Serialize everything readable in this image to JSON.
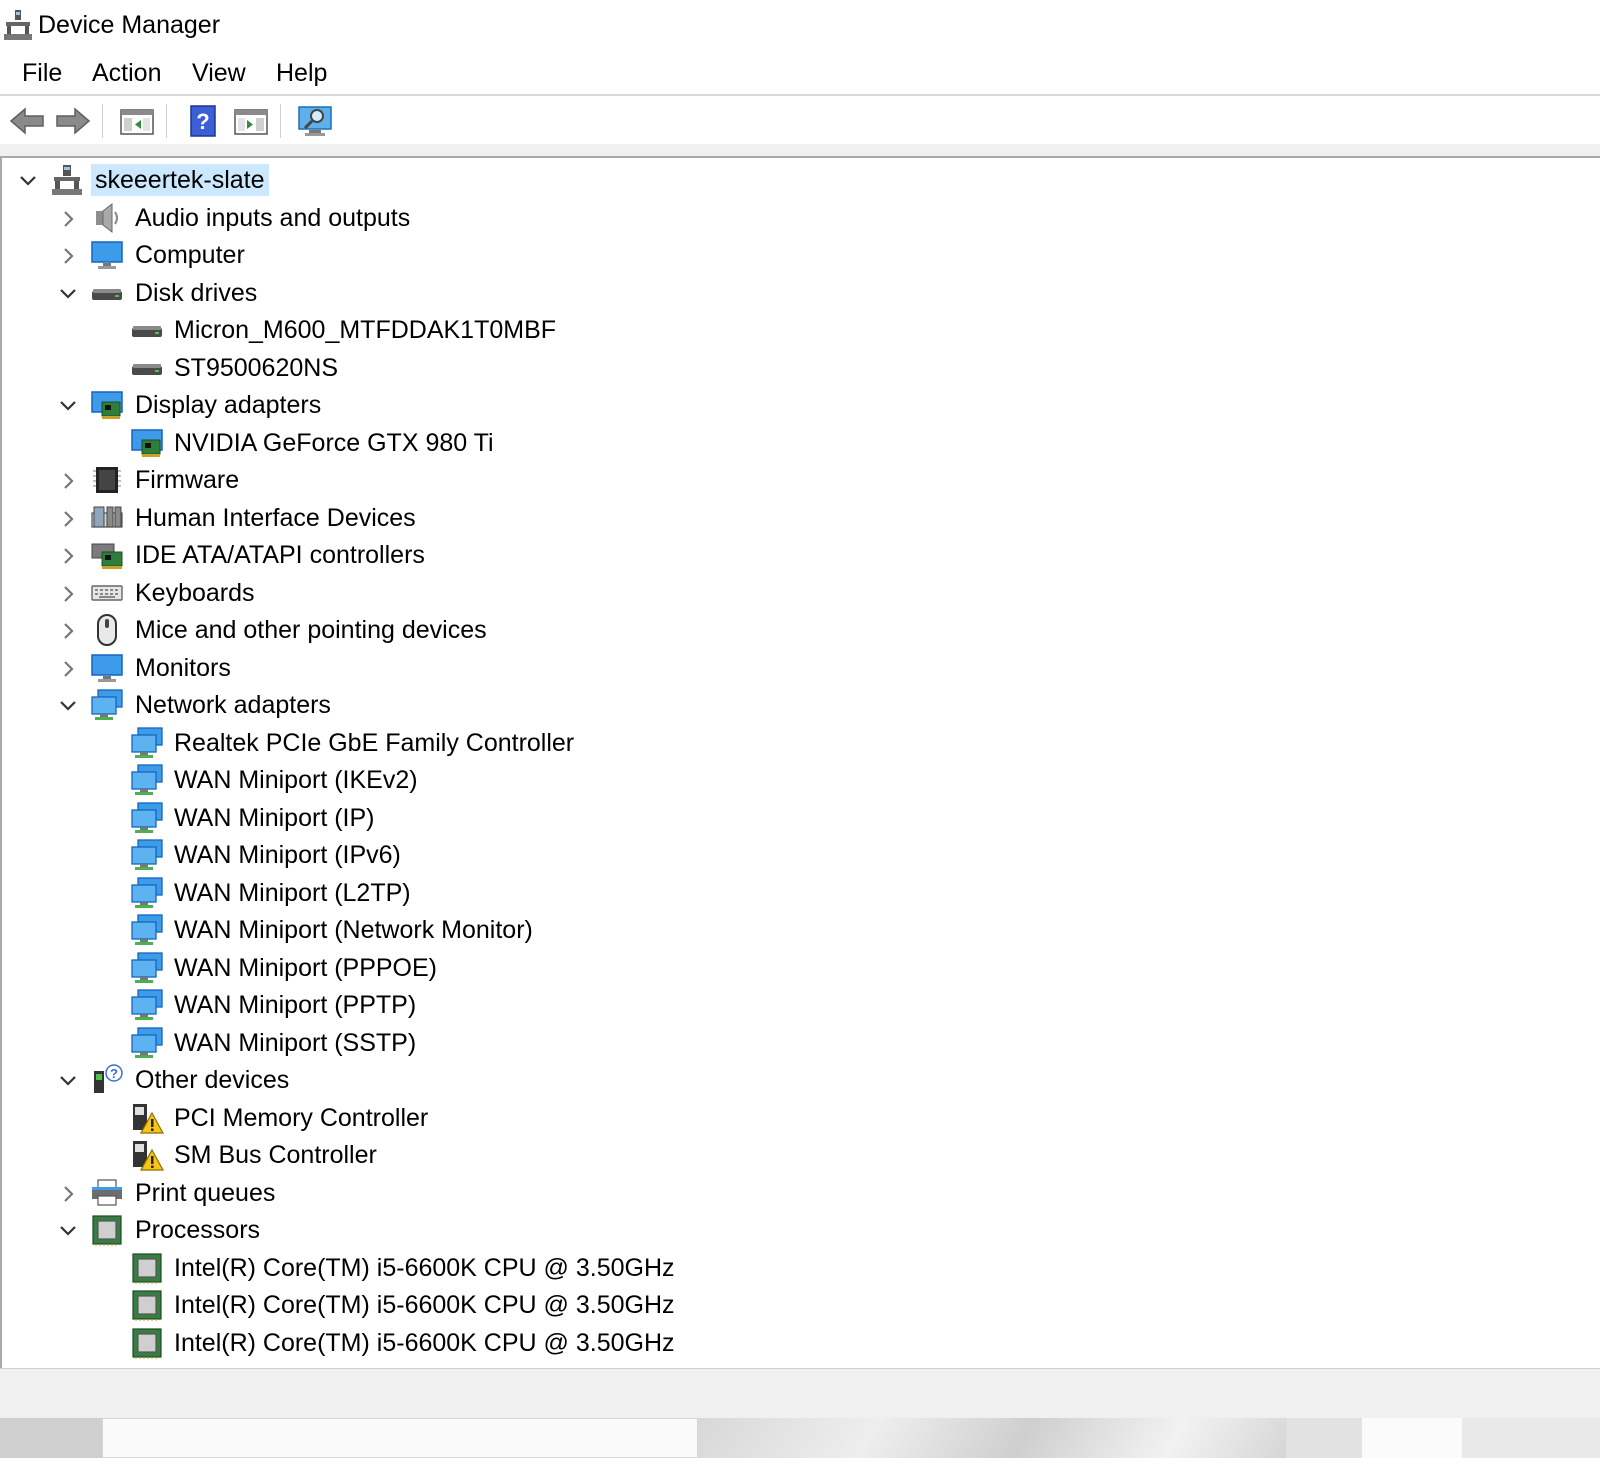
{
  "window": {
    "title": "Device Manager"
  },
  "menu": [
    {
      "name": "menu-file",
      "label": "File"
    },
    {
      "name": "menu-action",
      "label": "Action"
    },
    {
      "name": "menu-view",
      "label": "View"
    },
    {
      "name": "menu-help",
      "label": "Help"
    }
  ],
  "toolbar": [
    {
      "name": "back-button",
      "icon": "back-arrow-icon"
    },
    {
      "name": "forward-button",
      "icon": "forward-arrow-icon"
    },
    {
      "name": "show-hide-console-tree-button",
      "icon": "console-tree-icon"
    },
    {
      "name": "help-button",
      "icon": "help-icon"
    },
    {
      "name": "show-hide-action-pane-button",
      "icon": "action-pane-icon"
    },
    {
      "name": "scan-hardware-changes-button",
      "icon": "monitor-scan-icon"
    }
  ],
  "tree": {
    "root": {
      "label": "skeeertek-slate",
      "icon": "computer-network-icon",
      "expanded": true,
      "selected": true
    },
    "rows": [
      {
        "label": "Audio inputs and outputs",
        "icon": "speaker-icon",
        "level": 1,
        "expander": "collapsed"
      },
      {
        "label": "Computer",
        "icon": "monitor-icon",
        "level": 1,
        "expander": "collapsed"
      },
      {
        "label": "Disk drives",
        "icon": "disk-drive-icon",
        "level": 1,
        "expander": "expanded"
      },
      {
        "label": "Micron_M600_MTFDDAK1T0MBF",
        "icon": "disk-drive-icon",
        "level": 2,
        "expander": "none"
      },
      {
        "label": "ST9500620NS",
        "icon": "disk-drive-icon",
        "level": 2,
        "expander": "none"
      },
      {
        "label": "Display adapters",
        "icon": "display-adapter-icon",
        "level": 1,
        "expander": "expanded"
      },
      {
        "label": "NVIDIA GeForce GTX 980 Ti",
        "icon": "display-adapter-icon",
        "level": 2,
        "expander": "none"
      },
      {
        "label": "Firmware",
        "icon": "firmware-chip-icon",
        "level": 1,
        "expander": "collapsed"
      },
      {
        "label": "Human Interface Devices",
        "icon": "hid-icon",
        "level": 1,
        "expander": "collapsed"
      },
      {
        "label": "IDE ATA/ATAPI controllers",
        "icon": "ide-controller-icon",
        "level": 1,
        "expander": "collapsed"
      },
      {
        "label": "Keyboards",
        "icon": "keyboard-icon",
        "level": 1,
        "expander": "collapsed"
      },
      {
        "label": "Mice and other pointing devices",
        "icon": "mouse-icon",
        "level": 1,
        "expander": "collapsed"
      },
      {
        "label": "Monitors",
        "icon": "monitor-icon",
        "level": 1,
        "expander": "collapsed"
      },
      {
        "label": "Network adapters",
        "icon": "network-adapter-icon",
        "level": 1,
        "expander": "expanded"
      },
      {
        "label": "Realtek PCIe GbE Family Controller",
        "icon": "network-adapter-icon",
        "level": 2,
        "expander": "none"
      },
      {
        "label": "WAN Miniport (IKEv2)",
        "icon": "network-adapter-icon",
        "level": 2,
        "expander": "none"
      },
      {
        "label": "WAN Miniport (IP)",
        "icon": "network-adapter-icon",
        "level": 2,
        "expander": "none"
      },
      {
        "label": "WAN Miniport (IPv6)",
        "icon": "network-adapter-icon",
        "level": 2,
        "expander": "none"
      },
      {
        "label": "WAN Miniport (L2TP)",
        "icon": "network-adapter-icon",
        "level": 2,
        "expander": "none"
      },
      {
        "label": "WAN Miniport (Network Monitor)",
        "icon": "network-adapter-icon",
        "level": 2,
        "expander": "none"
      },
      {
        "label": "WAN Miniport (PPPOE)",
        "icon": "network-adapter-icon",
        "level": 2,
        "expander": "none"
      },
      {
        "label": "WAN Miniport (PPTP)",
        "icon": "network-adapter-icon",
        "level": 2,
        "expander": "none"
      },
      {
        "label": "WAN Miniport (SSTP)",
        "icon": "network-adapter-icon",
        "level": 2,
        "expander": "none"
      },
      {
        "label": "Other devices",
        "icon": "unknown-device-icon",
        "level": 1,
        "expander": "expanded"
      },
      {
        "label": "PCI Memory Controller",
        "icon": "warning-device-icon",
        "level": 2,
        "expander": "none"
      },
      {
        "label": "SM Bus Controller",
        "icon": "warning-device-icon",
        "level": 2,
        "expander": "none"
      },
      {
        "label": "Print queues",
        "icon": "printer-icon",
        "level": 1,
        "expander": "collapsed"
      },
      {
        "label": "Processors",
        "icon": "processor-icon",
        "level": 1,
        "expander": "expanded"
      },
      {
        "label": "Intel(R) Core(TM) i5-6600K CPU @ 3.50GHz",
        "icon": "processor-icon",
        "level": 2,
        "expander": "none"
      },
      {
        "label": "Intel(R) Core(TM) i5-6600K CPU @ 3.50GHz",
        "icon": "processor-icon",
        "level": 2,
        "expander": "none"
      },
      {
        "label": "Intel(R) Core(TM) i5-6600K CPU @ 3.50GHz",
        "icon": "processor-icon",
        "level": 2,
        "expander": "none"
      }
    ]
  },
  "colors": {
    "selection": "#cce8ff",
    "monitor_blue": "#1e88e5",
    "warning_yellow": "#f5c518",
    "chip_green": "#3a7d44"
  }
}
